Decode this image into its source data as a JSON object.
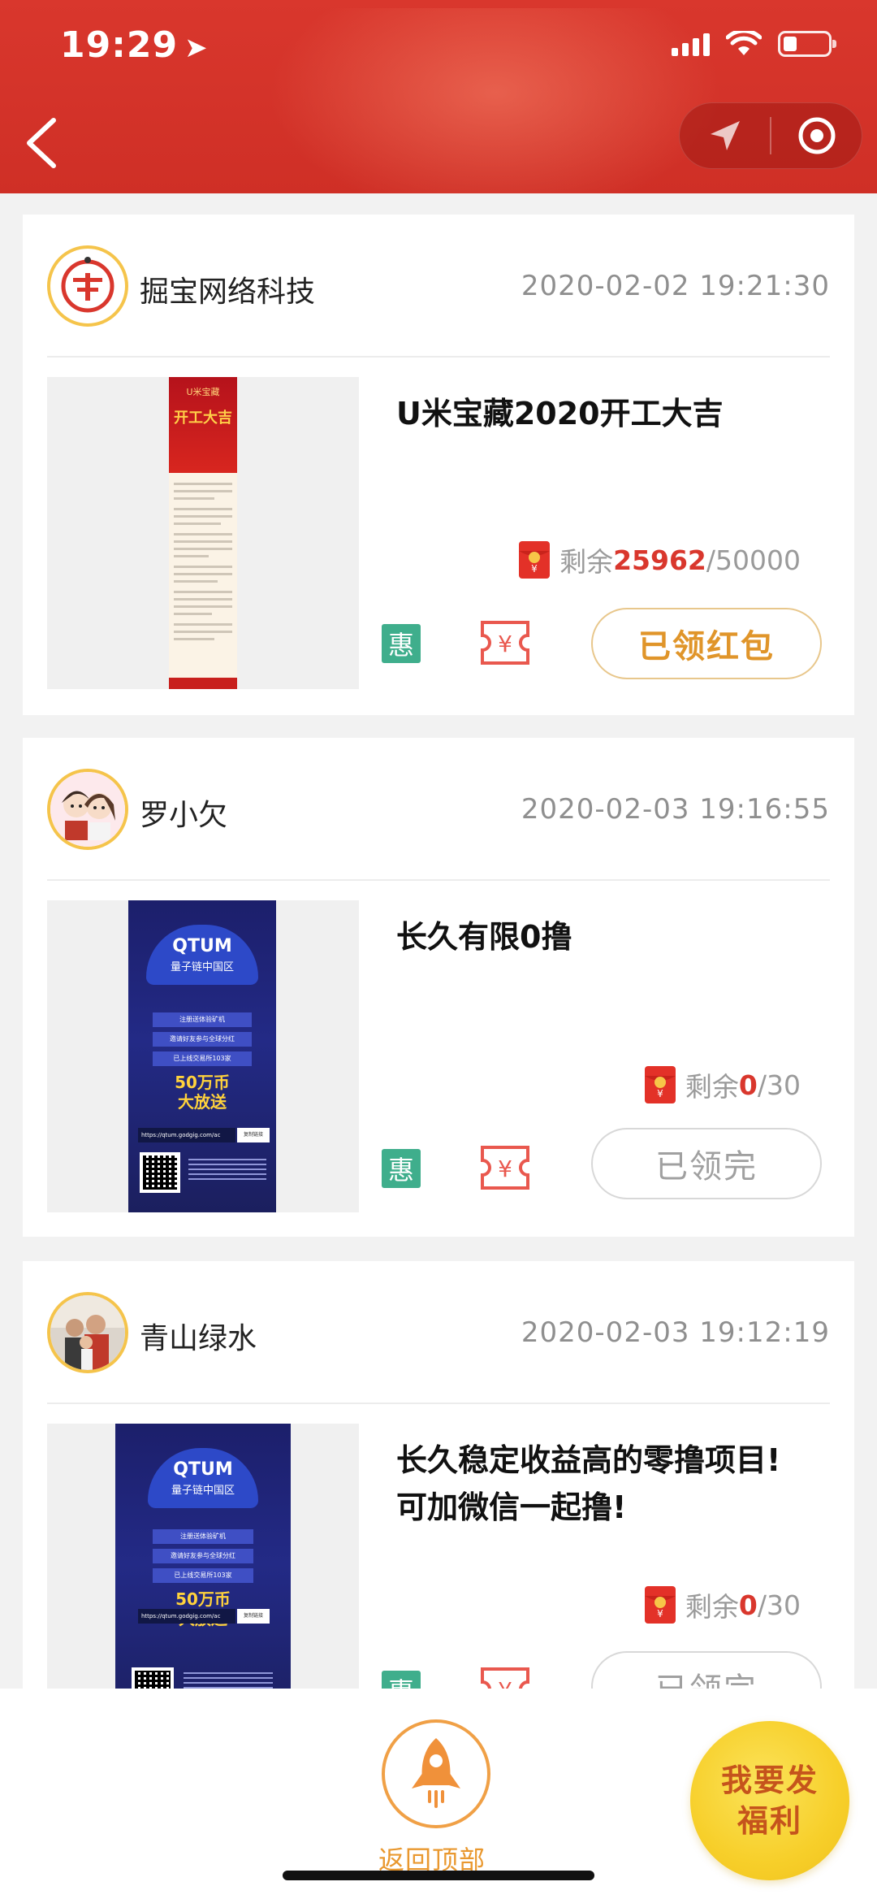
{
  "status_bar": {
    "time": "19:29"
  },
  "posts": [
    {
      "author": "掘宝网络科技",
      "time": "2020-02-02 19:21:30",
      "title": "U米宝藏2020开工大吉",
      "remain_label": "剩余",
      "remain_count": "25962",
      "remain_total": "/50000",
      "badge": "惠",
      "action": "已领红包",
      "thumb_banner": "U米宝藏",
      "thumb_headline": "开工大吉"
    },
    {
      "author": "罗小欠",
      "time": "2020-02-03 19:16:55",
      "title": "长久有限0撸",
      "remain_label": "剩余",
      "remain_count": "0",
      "remain_total": "/30",
      "badge": "惠",
      "action": "已领完",
      "thumb_brand": "QTUM",
      "thumb_sub": "量子链中国区",
      "thumb_lines": [
        "注册送体验矿机",
        "邀请好友参与全球分红",
        "已上线交易所103家"
      ],
      "thumb_promo": "50万币",
      "thumb_promo2": "大放送",
      "thumb_url": "https://qtum.godgig.com/ac",
      "thumb_copy": "复制链接"
    },
    {
      "author": "青山绿水",
      "time": "2020-02-03 19:12:19",
      "title": "长久稳定收益高的零撸项目!可加微信一起撸!",
      "remain_label": "剩余",
      "remain_count": "0",
      "remain_total": "/30",
      "badge": "惠",
      "action": "已领完",
      "thumb_brand": "QTUM",
      "thumb_sub": "量子链中国区",
      "thumb_lines": [
        "注册送体验矿机",
        "邀请好友参与全球分红",
        "已上线交易所103家"
      ],
      "thumb_promo": "50万币",
      "thumb_promo2": "大放送",
      "thumb_url": "https://qtum.godgig.com/ac",
      "thumb_copy": "复制链接"
    }
  ],
  "bottom": {
    "back_to_top": "返回顶部",
    "publish_line1": "我要发",
    "publish_line2": "福利"
  },
  "colors": {
    "header": "#d9372d",
    "accent_orange": "#e0952a",
    "badge_green": "#3fae8c"
  }
}
